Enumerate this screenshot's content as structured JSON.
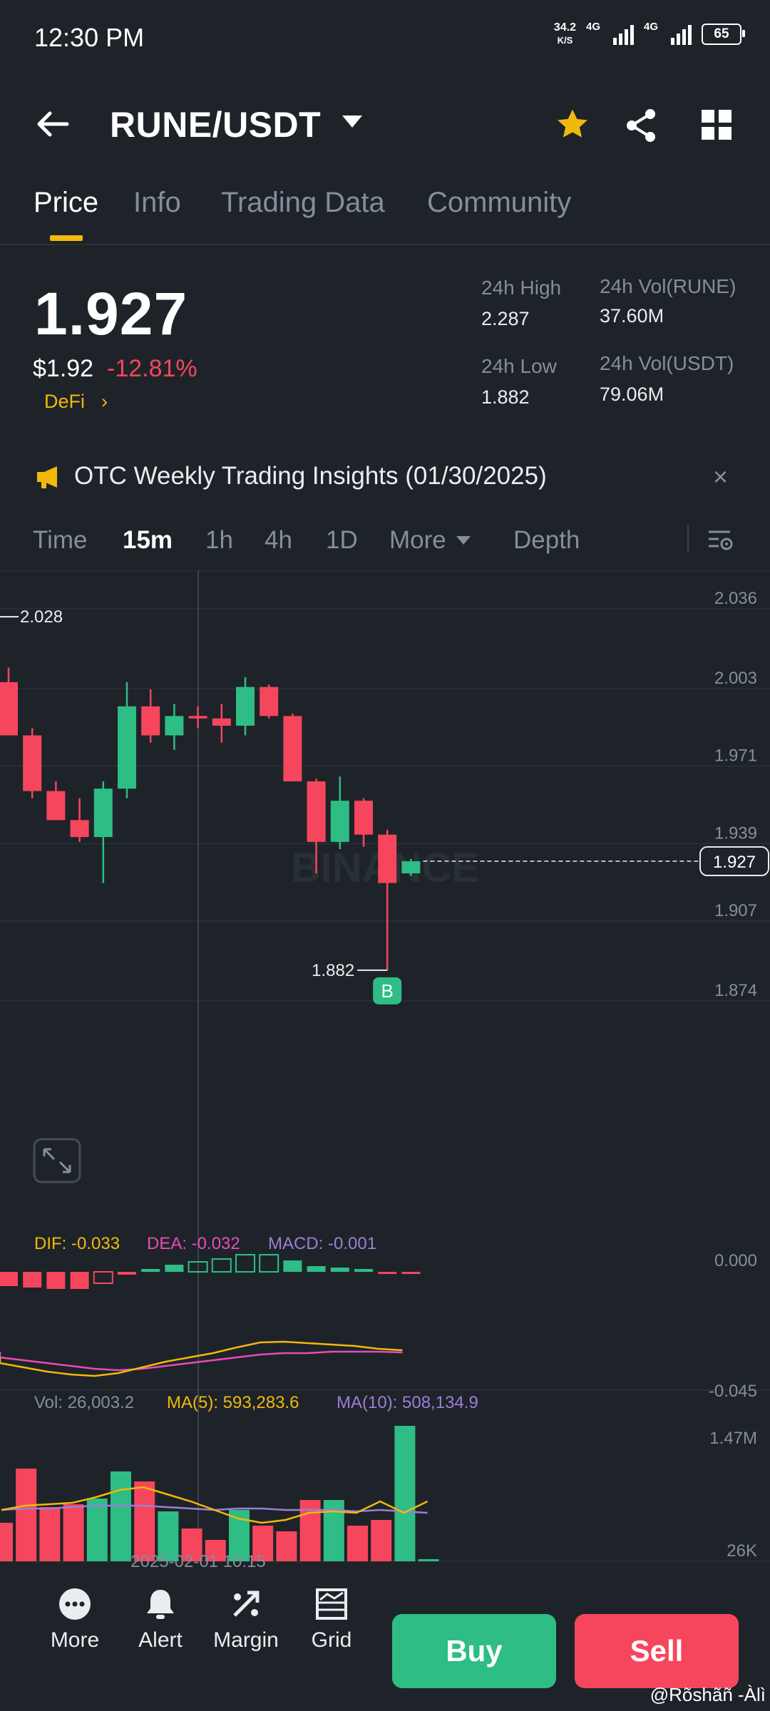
{
  "status_bar": {
    "time": "12:30 PM",
    "net_speed_top": "34.2",
    "net_speed_unit": "K/S",
    "sim1": "4G",
    "sim2": "4G",
    "battery": "65"
  },
  "header": {
    "pair": "RUNE/USDT",
    "icons": [
      "back-arrow-icon",
      "star-icon",
      "share-icon",
      "grid-icon"
    ],
    "favorite_color": "#f0b90b"
  },
  "tabs": [
    "Price",
    "Info",
    "Trading Data",
    "Community"
  ],
  "price": {
    "last": "1.927",
    "usd": "$1.92",
    "change": "-12.81%",
    "tag": "DeFi",
    "tag_arrow": "›",
    "stats": {
      "high_label": "24h High",
      "high_value": "2.287",
      "low_label": "24h Low",
      "low_value": "1.882",
      "vol_base_label": "24h Vol(RUNE)",
      "vol_base_value": "37.60M",
      "vol_quote_label": "24h Vol(USDT)",
      "vol_quote_value": "79.06M"
    }
  },
  "notice": {
    "text": "OTC Weekly Trading Insights (01/30/2025)",
    "close": "×"
  },
  "intervals": {
    "time": "Time",
    "m15": "15m",
    "h1": "1h",
    "h4": "4h",
    "d1": "1D",
    "more": "More",
    "depth": "Depth"
  },
  "colors": {
    "up": "#2ebd85",
    "down": "#f6465d",
    "accent": "#f0b90b",
    "background": "#1e2329"
  },
  "chart_data": {
    "type": "candlestick",
    "interval": "15m",
    "y_ticks": [
      "2.036",
      "2.003",
      "1.971",
      "1.939",
      "1.907",
      "1.874"
    ],
    "ylim": [
      1.874,
      2.036
    ],
    "max_marker": "2.028",
    "min_marker": "1.882",
    "current_price": "1.927",
    "buy_marker": "B",
    "watermark": "BINANCE",
    "candles": [
      {
        "o": 2.001,
        "h": 2.007,
        "l": 1.983,
        "c": 1.979
      },
      {
        "o": 1.979,
        "h": 1.982,
        "l": 1.953,
        "c": 1.956
      },
      {
        "o": 1.956,
        "h": 1.96,
        "l": 1.948,
        "c": 1.944
      },
      {
        "o": 1.944,
        "h": 1.953,
        "l": 1.935,
        "c": 1.937
      },
      {
        "o": 1.937,
        "h": 1.96,
        "l": 1.918,
        "c": 1.957
      },
      {
        "o": 1.957,
        "h": 2.001,
        "l": 1.953,
        "c": 1.991
      },
      {
        "o": 1.991,
        "h": 1.998,
        "l": 1.976,
        "c": 1.979
      },
      {
        "o": 1.979,
        "h": 1.992,
        "l": 1.973,
        "c": 1.987
      },
      {
        "o": 1.987,
        "h": 1.991,
        "l": 1.982,
        "c": 1.986
      },
      {
        "o": 1.986,
        "h": 1.992,
        "l": 1.976,
        "c": 1.983
      },
      {
        "o": 1.983,
        "h": 2.003,
        "l": 1.979,
        "c": 1.999
      },
      {
        "o": 1.999,
        "h": 2.0,
        "l": 1.986,
        "c": 1.987
      },
      {
        "o": 1.987,
        "h": 1.988,
        "l": 1.962,
        "c": 1.96
      },
      {
        "o": 1.96,
        "h": 1.961,
        "l": 1.922,
        "c": 1.935
      },
      {
        "o": 1.935,
        "h": 1.962,
        "l": 1.932,
        "c": 1.952
      },
      {
        "o": 1.952,
        "h": 1.953,
        "l": 1.933,
        "c": 1.938
      },
      {
        "o": 1.938,
        "h": 1.94,
        "l": 1.882,
        "c": 1.918
      },
      {
        "o": 1.922,
        "h": 1.928,
        "l": 1.921,
        "c": 1.927
      }
    ],
    "macd": {
      "dif_label": "DIF: -0.033",
      "dea_label": "DEA: -0.032",
      "macd_label": "MACD: -0.001",
      "y_ticks": [
        "0.000",
        "-0.045"
      ]
    },
    "volume": {
      "vol_label": "Vol: 26,003.2",
      "ma5_label": "MA(5): 593,283.6",
      "ma10_label": "MA(10): 508,134.9",
      "y_ticks": [
        "1.47M",
        "26K"
      ],
      "time_label": "2025-02-01 10:15"
    }
  },
  "bottom_nav": {
    "more": "More",
    "alert": "Alert",
    "margin": "Margin",
    "grid": "Grid",
    "buy": "Buy",
    "sell": "Sell"
  },
  "credit": "@Rõshãñ -Àlì"
}
